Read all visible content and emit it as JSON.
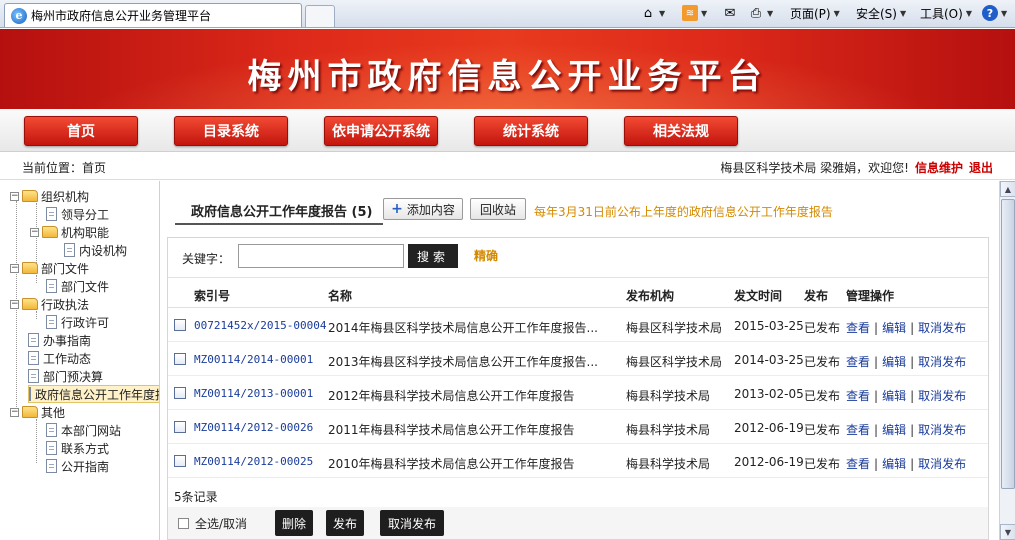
{
  "browser": {
    "tab_title": "梅州市政府信息公开业务管理平台",
    "page_label": "页面(P)",
    "safety_label": "安全(S)",
    "tools_label": "工具(O)"
  },
  "banner": {
    "title": "梅州市政府信息公开业务平台"
  },
  "nav": {
    "items": [
      {
        "label": "首页"
      },
      {
        "label": "目录系统"
      },
      {
        "label": "依申请公开系统"
      },
      {
        "label": "统计系统"
      },
      {
        "label": "相关法规"
      }
    ]
  },
  "location": {
    "current": "当前位置：首页",
    "user": "梅县区科学技术局 梁雅娟，欢迎您!",
    "info_maint": "信息维护",
    "logout": "退出"
  },
  "tree": {
    "n0": "组织机构",
    "n1": "领导分工",
    "n2": "机构职能",
    "n3": "内设机构",
    "n4": "部门文件",
    "n5": "部门文件",
    "n6": "行政执法",
    "n7": "行政许可",
    "n8": "办事指南",
    "n9": "工作动态",
    "n10": "部门预决算",
    "n11": "政府信息公开工作年度报告",
    "n12": "其他",
    "n13": "本部门网站",
    "n14": "联系方式",
    "n15": "公开指南"
  },
  "main": {
    "tab_label": "政府信息公开工作年度报告 (5)",
    "add_button": "添加内容",
    "recycle_button": "回收站",
    "notice": "每年3月31日前公布上年度的政府信息公开工作年度报告",
    "keyword_label": "关键字：",
    "keyword_value": "",
    "search_button": "搜索",
    "exact_label": "精确",
    "columns": {
      "index": "索引号",
      "name": "名称",
      "org": "发布机构",
      "date": "发文时间",
      "status": "发布",
      "ops": "管理操作"
    },
    "rows": [
      {
        "index": "00721452x/2015-00004",
        "name": "2014年梅县区科学技术局信息公开工作年度报告...",
        "org": "梅县区科学技术局",
        "date": "2015-03-25",
        "status": "已发布"
      },
      {
        "index": "MZ00114/2014-00001",
        "name": "2013年梅县区科学技术局信息公开工作年度报告...",
        "org": "梅县区科学技术局",
        "date": "2014-03-25",
        "status": "已发布"
      },
      {
        "index": "MZ00114/2013-00001",
        "name": "2012年梅县科学技术局信息公开工作年度报告",
        "org": "梅县科学技术局",
        "date": "2013-02-05",
        "status": "已发布"
      },
      {
        "index": "MZ00114/2012-00026",
        "name": "2011年梅县科学技术局信息公开工作年度报告",
        "org": "梅县科学技术局",
        "date": "2012-06-19",
        "status": "已发布"
      },
      {
        "index": "MZ00114/2012-00025",
        "name": "2010年梅县科学技术局信息公开工作年度报告",
        "org": "梅县科学技术局",
        "date": "2012-06-19",
        "status": "已发布"
      }
    ],
    "op_view": "查看",
    "op_edit": "编辑",
    "op_unpublish": "取消发布",
    "records": "5条记录",
    "select_all": "全选/取消",
    "delete_button": "删除",
    "publish_button": "发布",
    "unpublish_button": "取消发布"
  },
  "colors": {
    "banner_red": "#de2a1a",
    "notice_orange": "#d48a00",
    "link_blue": "#1a3c9a"
  }
}
